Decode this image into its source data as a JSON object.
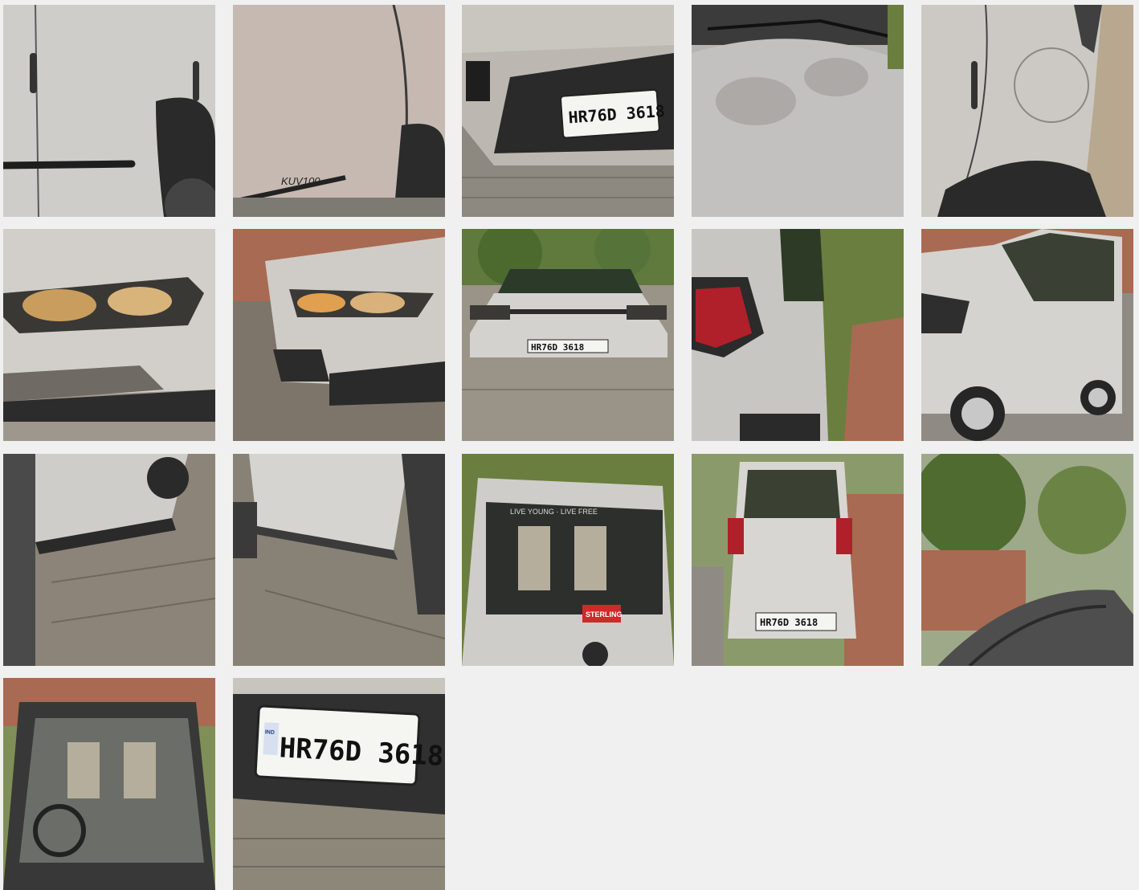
{
  "gallery": {
    "plate_number": "HR76D 3618",
    "plate_country": "IND",
    "badge_model": "KUV100",
    "dealer_sticker": "STERLING",
    "window_text": "LIVE YOUNG · LIVE FREE",
    "colors": {
      "background": "#f0f0f0",
      "car_silver": "#d6d4d0",
      "paver": "#9a948a",
      "foliage": "#5f7a3c",
      "wall_brick": "#a86a52"
    },
    "photos": [
      {
        "label": "Front door side panel"
      },
      {
        "label": "Rear door with badge"
      },
      {
        "label": "Front bumper with number plate"
      },
      {
        "label": "Bonnet top view"
      },
      {
        "label": "Rear quarter with fuel lid"
      },
      {
        "label": "Headlamp close-up"
      },
      {
        "label": "Front bumper angle"
      },
      {
        "label": "Full front view"
      },
      {
        "label": "Rear tail lamp side"
      },
      {
        "label": "Left front three-quarter"
      },
      {
        "label": "Lower door sill left"
      },
      {
        "label": "Lower door sill right"
      },
      {
        "label": "Rear windshield"
      },
      {
        "label": "Full rear view"
      },
      {
        "label": "Roof view"
      },
      {
        "label": "Windshield interior view"
      },
      {
        "label": "Number plate close-up"
      }
    ]
  }
}
